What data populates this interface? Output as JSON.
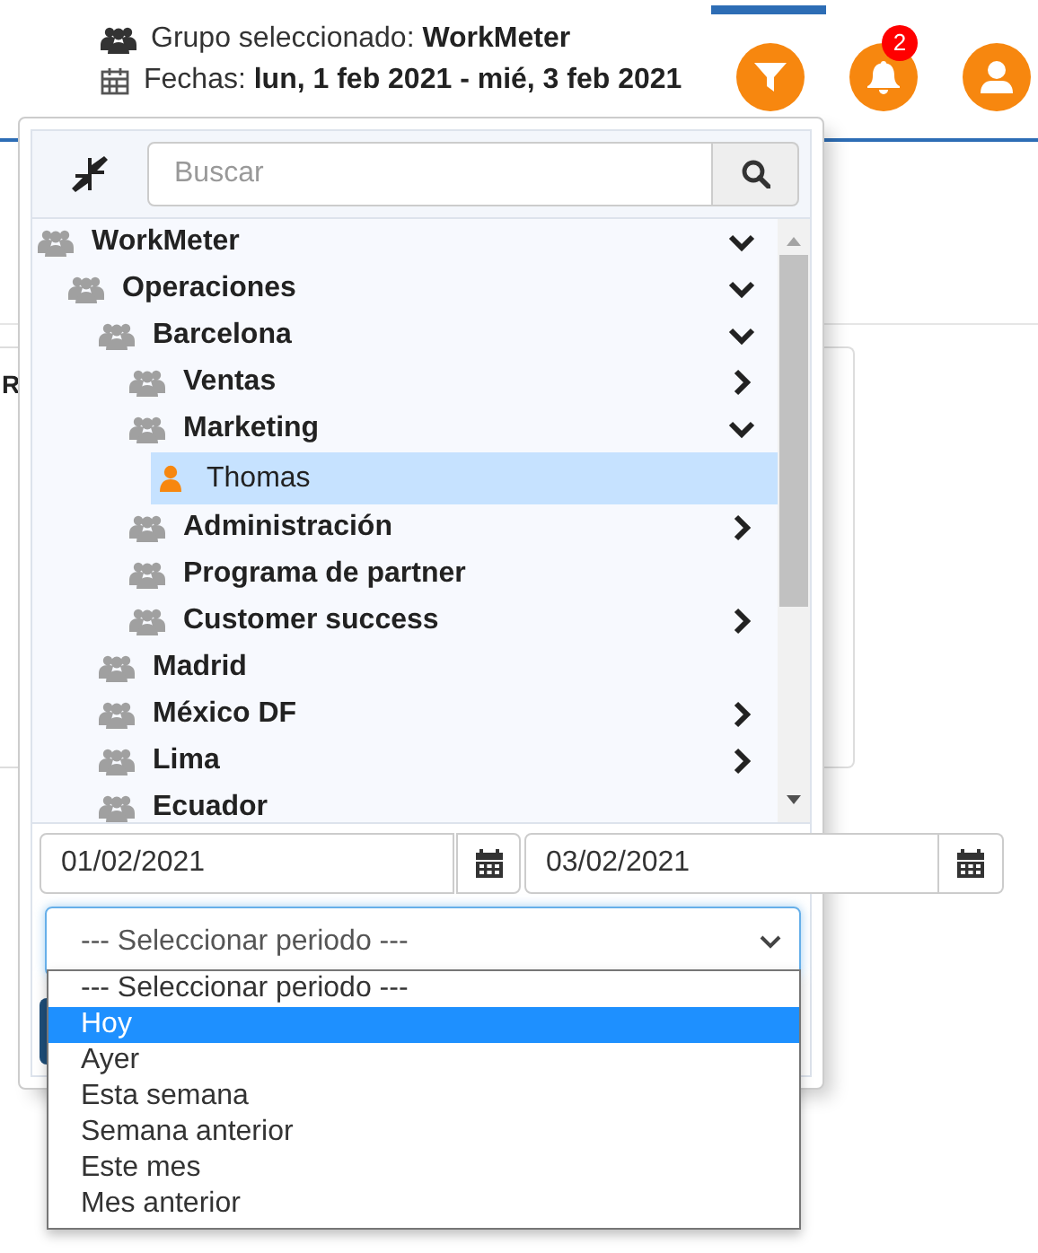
{
  "header": {
    "group_label": "Grupo seleccionado:",
    "group_value": "WorkMeter",
    "dates_label": "Fechas:",
    "dates_value": "lun, 1 feb 2021 - mié, 3 feb 2021"
  },
  "actions": [
    {
      "kind": "filter"
    },
    {
      "kind": "notifications",
      "badge": "2"
    },
    {
      "kind": "user"
    }
  ],
  "background_card": {
    "text": "R"
  },
  "popup": {
    "search": {
      "placeholder": "Buscar"
    },
    "tree": [
      {
        "label": "WorkMeter",
        "kind": "group",
        "expanded": true,
        "selected": false,
        "children": [
          {
            "label": "Operaciones",
            "kind": "group",
            "expanded": true,
            "selected": false,
            "children": [
              {
                "label": "Barcelona",
                "kind": "group",
                "expanded": true,
                "selected": false,
                "children": [
                  {
                    "label": "Ventas",
                    "kind": "group",
                    "expanded": false,
                    "selected": false
                  },
                  {
                    "label": "Marketing",
                    "kind": "group",
                    "expanded": true,
                    "selected": false,
                    "children": [
                      {
                        "label": "Thomas",
                        "kind": "person",
                        "selected": true
                      }
                    ]
                  },
                  {
                    "label": "Administración",
                    "kind": "group",
                    "expanded": false,
                    "selected": false
                  },
                  {
                    "label": "Programa de partner",
                    "kind": "group",
                    "selected": false
                  },
                  {
                    "label": "Customer success",
                    "kind": "group",
                    "expanded": false,
                    "selected": false
                  }
                ]
              },
              {
                "label": "Madrid",
                "kind": "group",
                "selected": false
              },
              {
                "label": "México DF",
                "kind": "group",
                "expanded": false,
                "selected": false
              },
              {
                "label": "Lima",
                "kind": "group",
                "expanded": false,
                "selected": false
              },
              {
                "label": "Ecuador",
                "kind": "group",
                "selected": false
              }
            ]
          }
        ]
      }
    ],
    "date_from": "01/02/2021",
    "date_to": "03/02/2021",
    "period": {
      "value": "--- Seleccionar periodo ---",
      "options": [
        {
          "label": "--- Seleccionar periodo ---",
          "highlighted": false
        },
        {
          "label": "Hoy",
          "highlighted": true
        },
        {
          "label": "Ayer",
          "highlighted": false
        },
        {
          "label": "Esta semana",
          "highlighted": false
        },
        {
          "label": "Semana anterior",
          "highlighted": false
        },
        {
          "label": "Este mes",
          "highlighted": false
        },
        {
          "label": "Mes anterior",
          "highlighted": false
        }
      ]
    }
  }
}
